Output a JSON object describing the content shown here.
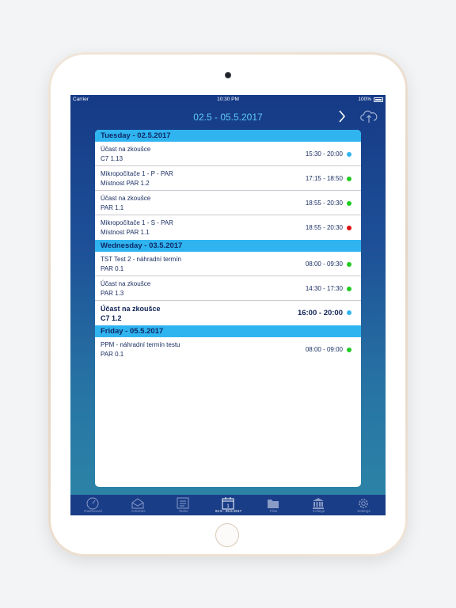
{
  "status_bar": {
    "carrier": "Carrier",
    "time": "10:30 PM",
    "battery": "100%"
  },
  "nav": {
    "title": "02.5 - 05.5.2017"
  },
  "days": [
    {
      "header": "Tuesday - 02.5.2017",
      "items": [
        {
          "title": "Účast na zkoušce",
          "room": "C7 1.13",
          "time": "15:30 - 20:00",
          "dot": "#2fb4f0"
        },
        {
          "title": "Mikropočítače 1 - P - PAR",
          "room": "Místnost PAR 1.2",
          "time": "17:15 - 18:50",
          "dot": "#22cc22"
        },
        {
          "title": "Účast na zkoušce",
          "room": "PAR 1.1",
          "time": "18:55 - 20:30",
          "dot": "#22cc22"
        },
        {
          "title": "Mikropočítače 1 - S - PAR",
          "room": "Místnost PAR 1.1",
          "time": "18:55 - 20:30",
          "dot": "#dd1111"
        }
      ]
    },
    {
      "header": "Wednesday - 03.5.2017",
      "items": [
        {
          "title": "TST Test 2 - náhradní termín",
          "room": "PAR 0.1",
          "time": "08:00 - 09:30",
          "dot": "#22cc22"
        },
        {
          "title": "Účast na zkoušce",
          "room": "PAR 1.3",
          "time": "14:30 - 17:30",
          "dot": "#22cc22"
        },
        {
          "title": "Účast na zkoušce",
          "room": "C7 1.2",
          "time": "16:00 - 20:00",
          "dot": "#2fb4f0",
          "bold": true
        }
      ]
    },
    {
      "header": "Friday - 05.5.2017",
      "items": [
        {
          "title": "PPM - náhradní termín testu",
          "room": "PAR 0.1",
          "time": "08:00 - 09:00",
          "dot": "#22cc22"
        }
      ]
    }
  ],
  "tabs": [
    {
      "label": "Dashboard",
      "icon": "speedometer-icon"
    },
    {
      "label": "Activities",
      "icon": "inbox-icon"
    },
    {
      "label": "Tasks",
      "icon": "tasks-icon"
    },
    {
      "label": "02.5 - 05.5.2017",
      "icon": "calendar-icon",
      "active": true
    },
    {
      "label": "Files",
      "icon": "folder-icon"
    },
    {
      "label": "College",
      "icon": "college-icon"
    },
    {
      "label": "Settings",
      "icon": "gear-icon"
    }
  ]
}
